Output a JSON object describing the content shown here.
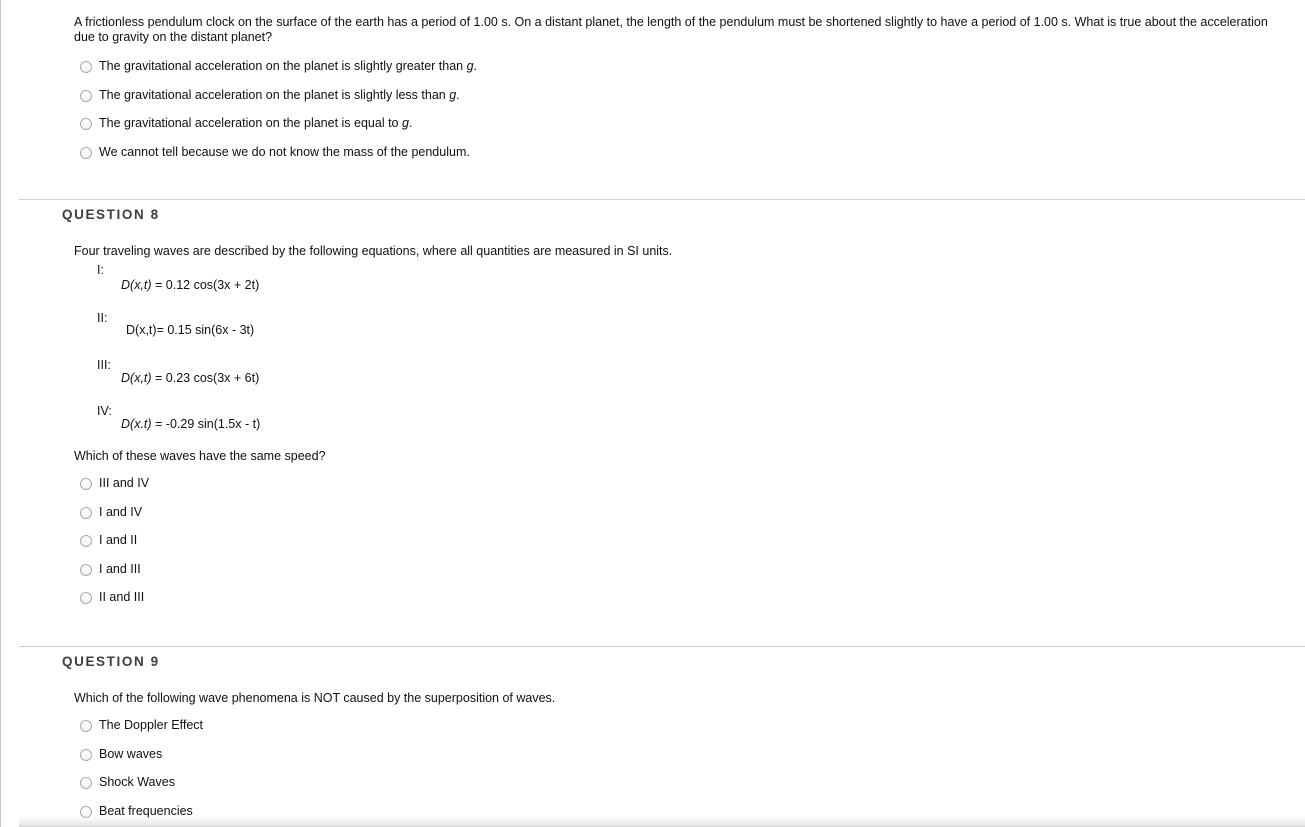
{
  "question7": {
    "prompt": "A frictionless pendulum clock on the surface of the earth has a period of 1.00 s. On a distant planet, the length of the pendulum must be shortened slightly to have a period of 1.00 s. What is true about the acceleration due to gravity on the distant planet?",
    "answers": [
      {
        "text": "The gravitational acceleration on the planet is slightly greater than ",
        "var": "g",
        "tail": "."
      },
      {
        "text": "The gravitational acceleration on the planet is slightly less than ",
        "var": "g",
        "tail": "."
      },
      {
        "text": "The gravitational acceleration on the planet is equal to ",
        "var": "g",
        "tail": "."
      },
      {
        "text": "We cannot tell because we do not know the mass of the pendulum.",
        "var": "",
        "tail": ""
      }
    ]
  },
  "question8": {
    "heading": "QUESTION 8",
    "prompt": "Four traveling waves are described by the following equations, where all quantities are measured in SI units.",
    "equations": [
      {
        "label": "I:",
        "lhs": "D(x,t)",
        "rhs": " = 0.12 cos(3x + 2t)"
      },
      {
        "label": "II:",
        "lhs": "D(x,t)",
        "rhs": "= 0.15 sin(6x - 3t)"
      },
      {
        "label": "III:",
        "lhs": "D(x,t)",
        "rhs": " = 0.23 cos(3x + 6t)"
      },
      {
        "label": "IV:",
        "lhs": "D(x.t)",
        "rhs": " = -0.29 sin(1.5x - t)"
      }
    ],
    "subprompt": "Which of these waves have the same speed?",
    "answers": [
      {
        "text": "III and IV"
      },
      {
        "text": "I and IV"
      },
      {
        "text": "I and II"
      },
      {
        "text": "I and III"
      },
      {
        "text": "II and III"
      }
    ]
  },
  "question9": {
    "heading": "QUESTION 9",
    "prompt": "Which of the following wave phenomena is NOT caused by the superposition of waves.",
    "answers": [
      {
        "text": "The Doppler Effect"
      },
      {
        "text": "Bow waves"
      },
      {
        "text": "Shock Waves"
      },
      {
        "text": "Beat frequencies"
      }
    ]
  }
}
